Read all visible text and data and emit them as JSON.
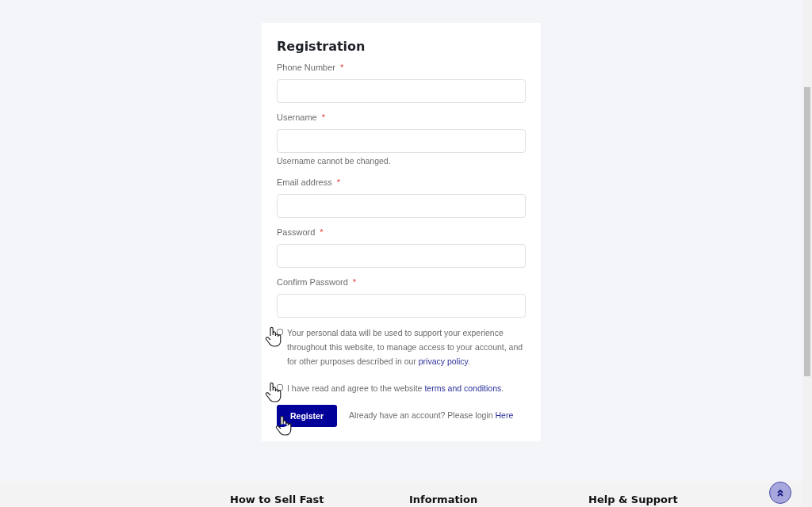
{
  "form": {
    "title": "Registration",
    "fields": [
      {
        "label": "Phone Number",
        "required_mark": "*"
      },
      {
        "label": "Username",
        "required_mark": "*",
        "help": "Username cannot be changed."
      },
      {
        "label": "Email address",
        "required_mark": "*"
      },
      {
        "label": "Password",
        "required_mark": "*"
      },
      {
        "label": "Confirm Password",
        "required_mark": "*"
      }
    ],
    "consents": [
      {
        "text": "Your personal data will be used to support your experience throughout this website, to manage access to your account, and for other purposes described in our ",
        "link": "privacy policy",
        "after": ".",
        "checked": false
      },
      {
        "text": "I have read and agree to the website ",
        "link": "terms and conditions",
        "after": ".",
        "checked": false
      }
    ],
    "submit": "Register",
    "login_text": "Already have an account? Please login ",
    "login_link": "Here"
  },
  "footer": {
    "headings": [
      "How to Sell Fast",
      "Information",
      "Help & Support"
    ]
  }
}
